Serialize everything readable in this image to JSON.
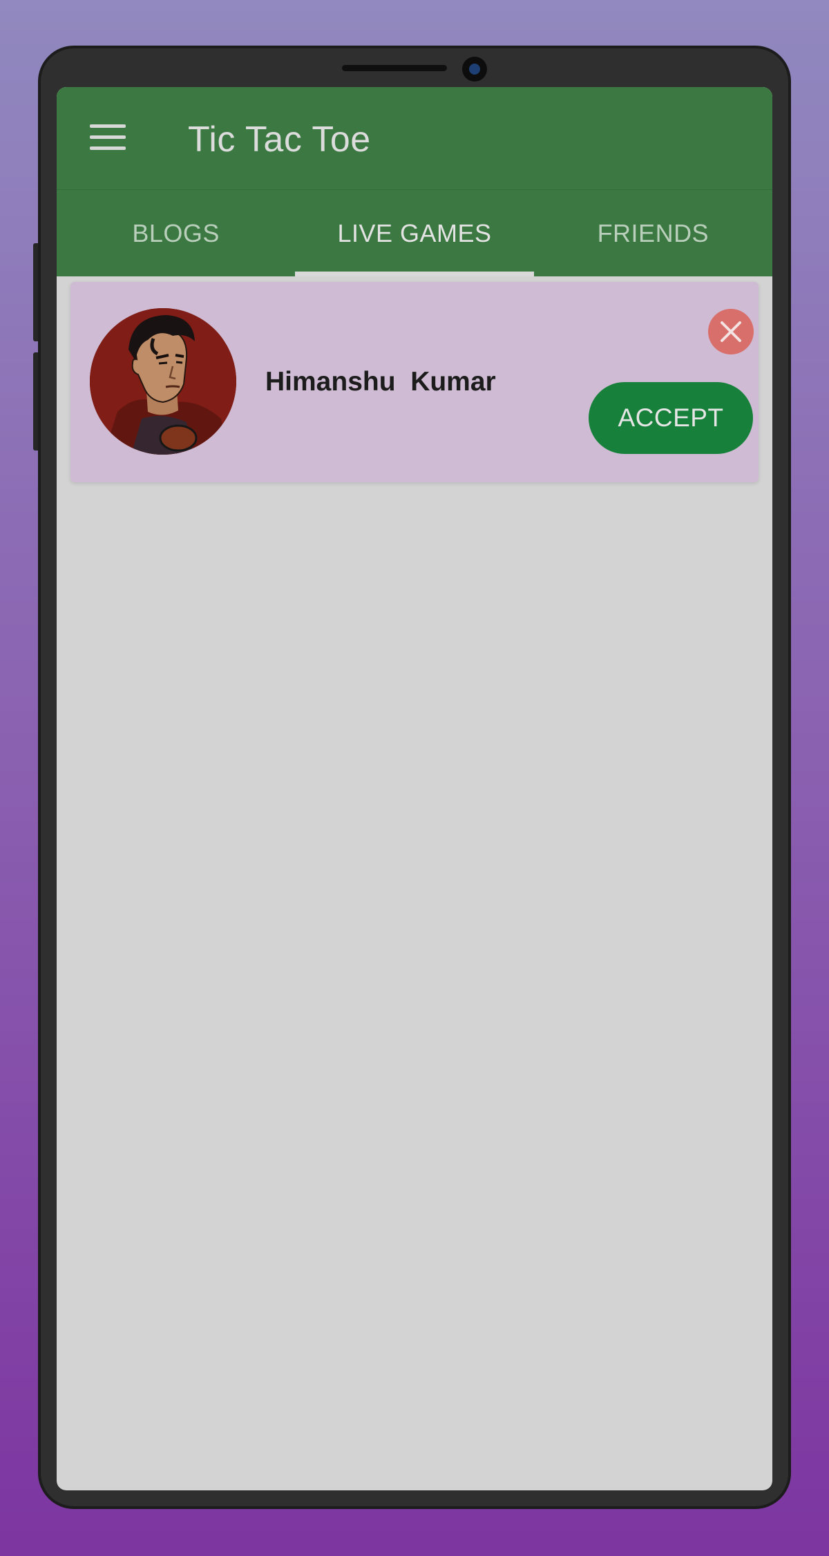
{
  "app": {
    "title": "Tic Tac Toe"
  },
  "tabs": [
    {
      "label": "BLOGS",
      "active": false
    },
    {
      "label": "LIVE GAMES",
      "active": true
    },
    {
      "label": "FRIENDS",
      "active": false
    }
  ],
  "invite_card": {
    "player_name": "Himanshu  Kumar",
    "accept_label": "ACCEPT",
    "avatar_icon": "profile-avatar",
    "decline_icon": "close-icon"
  },
  "colors": {
    "app_bar": "#3c7942",
    "accept_button": "#17803b",
    "decline_button": "#d86f6a",
    "card_background": "#cfbcd4",
    "screen_background": "#d3d3d3"
  }
}
